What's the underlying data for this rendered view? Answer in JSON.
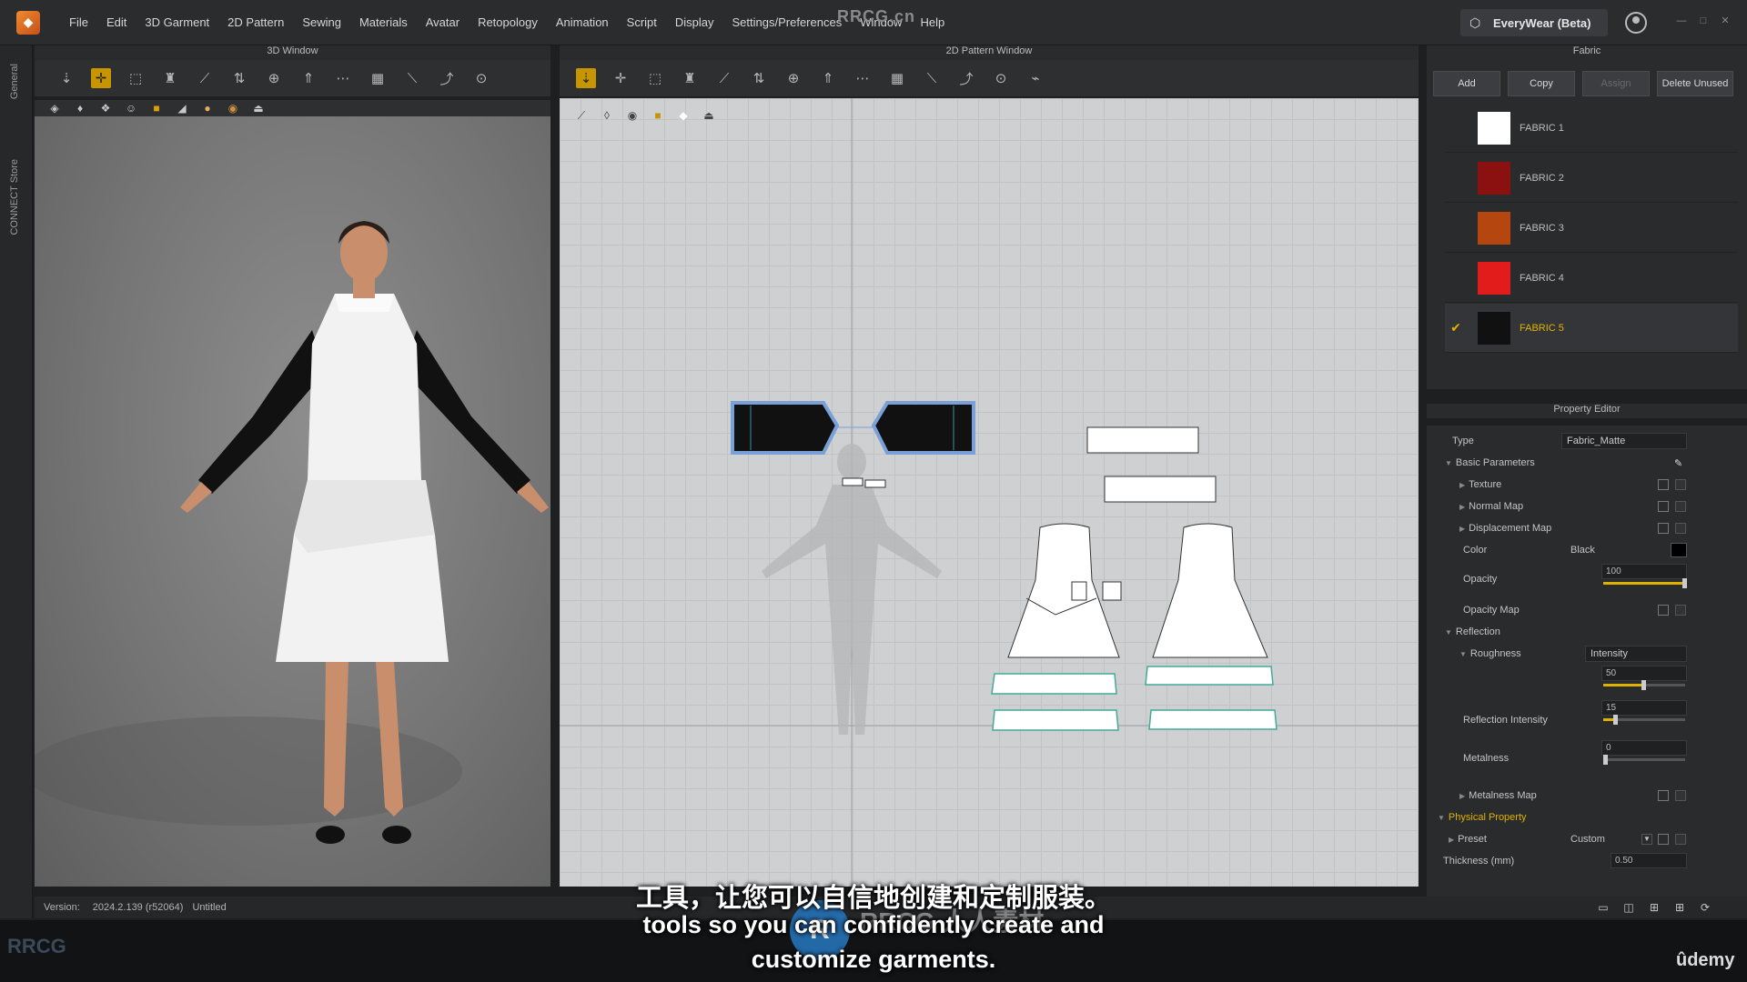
{
  "menu": {
    "items": [
      "File",
      "Edit",
      "3D Garment",
      "2D Pattern",
      "Sewing",
      "Materials",
      "Avatar",
      "Retopology",
      "Animation",
      "Script",
      "Display",
      "Settings/Preferences",
      "Window",
      "Help"
    ],
    "account_label": "EveryWear (Beta)",
    "watermark": "RRCG.cn"
  },
  "side_strip": {
    "general": "General",
    "connect": "CONNECT Store"
  },
  "panels": {
    "view3d_title": "3D Window",
    "view2d_title": "2D Pattern Window",
    "fabric_title": "Fabric",
    "property_title": "Property Editor"
  },
  "fabric": {
    "buttons": {
      "add": "Add",
      "copy": "Copy",
      "assign": "Assign",
      "delete_unused": "Delete Unused"
    },
    "items": [
      {
        "name": "FABRIC 1",
        "color": "#ffffff",
        "selected": false
      },
      {
        "name": "FABRIC 2",
        "color": "#8b1010",
        "selected": false
      },
      {
        "name": "FABRIC 3",
        "color": "#b5460f",
        "selected": false
      },
      {
        "name": "FABRIC 4",
        "color": "#e21b1b",
        "selected": false
      },
      {
        "name": "FABRIC 5",
        "color": "#111111",
        "selected": true
      }
    ]
  },
  "property": {
    "type_label": "Type",
    "type_value": "Fabric_Matte",
    "basic_parameters": "Basic Parameters",
    "texture": "Texture",
    "normal_map": "Normal Map",
    "displacement_map": "Displacement Map",
    "color_label": "Color",
    "color_value": "Black",
    "opacity_label": "Opacity",
    "opacity_value": "100",
    "opacity_level": 1.0,
    "opacity_map": "Opacity Map",
    "reflection": "Reflection",
    "roughness_label": "Roughness",
    "roughness_mode": "Intensity",
    "roughness_value": "50",
    "roughness_level": 0.5,
    "reflection_intensity_label": "Reflection Intensity",
    "reflection_intensity_value": "15",
    "reflection_intensity_level": 0.15,
    "metalness_label": "Metalness",
    "metalness_value": "0",
    "metalness_level": 0.0,
    "metalness_map": "Metalness Map",
    "physical_property": "Physical Property",
    "preset_label": "Preset",
    "preset_value": "Custom",
    "thickness_label": "Thickness (mm)",
    "thickness_value": "0.50"
  },
  "status": {
    "version_label": "Version:",
    "version_value": "2024.2.139 (r52064)",
    "file_name": "Untitled"
  },
  "subtitles": {
    "cn": "工具，让您可以自信地创建和定制服装。",
    "en_line1": "tools so you can confidently create and",
    "en_line2": "customize garments."
  },
  "branding": {
    "udemy": "ûdemy",
    "watermark_text": "RRCG 人人素材",
    "bottom_logo": "RRCG"
  },
  "icons": {
    "toolbar3d": [
      "select-icon",
      "move-icon",
      "transform-icon",
      "fold-icon",
      "draw-line-icon",
      "arrange-icon",
      "tack-icon",
      "pin-icon",
      "measure-icon",
      "grid-icon",
      "edit-curve-icon",
      "sewing-icon",
      "point-icon"
    ],
    "toolbar2d": [
      "pattern-select-icon",
      "edit-point-icon",
      "rectangle-icon",
      "internal-shape-icon",
      "notch-icon",
      "curve-icon",
      "grid-icon",
      "seam-icon",
      "sew-icon",
      "segment-icon",
      "pleat-icon",
      "measure-icon",
      "line-icon",
      "garment-icon"
    ]
  }
}
